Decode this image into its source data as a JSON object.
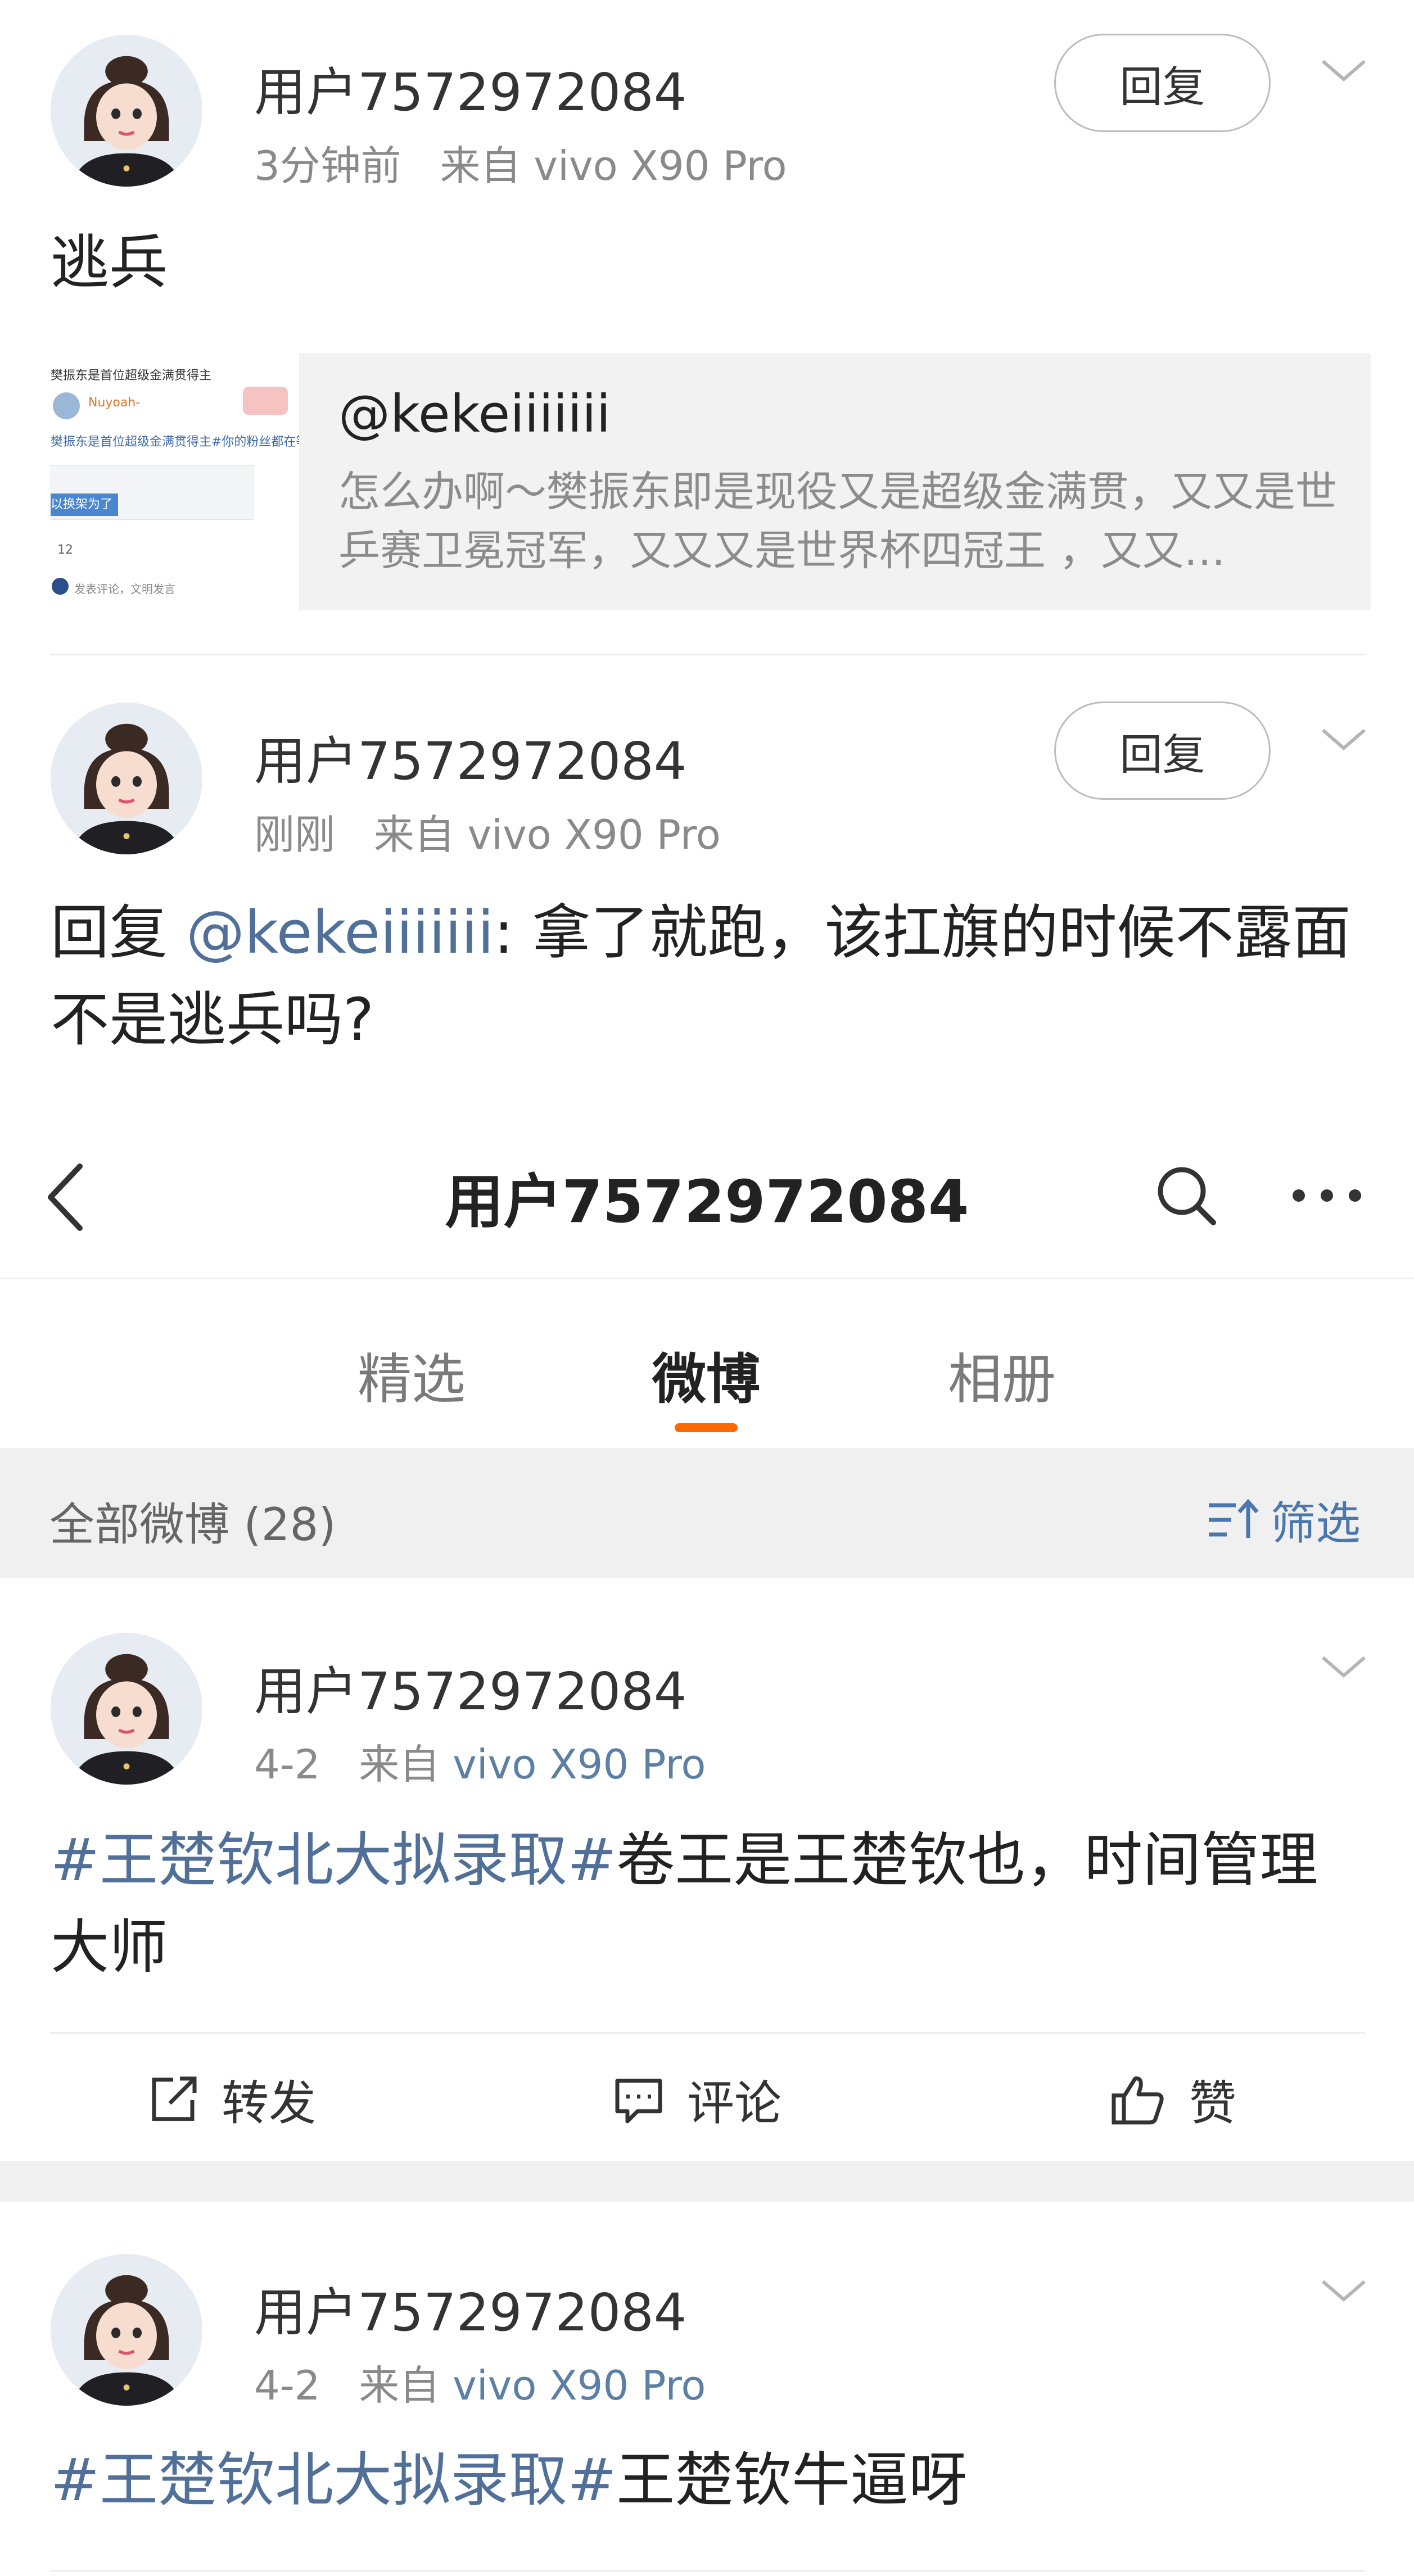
{
  "comment1": {
    "username": "用户7572972084",
    "time": "3分钟前",
    "source": "来自 vivo X90 Pro",
    "reply_label": "回复",
    "text": "逃兵",
    "quote": {
      "thumb_line1": "樊振东是首位超级金满贯得主",
      "thumb_line2": "Nuyoah-",
      "thumb_line3": "樊振东是首位超级金满贯得主#你的粉丝都在等",
      "thumb_line4": "以换架为了",
      "thumb_count": "12",
      "thumb_footer": "发表评论，文明发言",
      "title": "@kekeiiiiiii",
      "text": "怎么办啊～樊振东即是现役又是超级金满贯，又又是世乒赛卫冕冠军，又又又是世界杯四冠王 ，又又…"
    }
  },
  "comment2": {
    "username": "用户7572972084",
    "time": "刚刚",
    "source": "来自 vivo X90 Pro",
    "reply_label": "回复",
    "text_prefix": "回复 ",
    "mention": "@kekeiiiiiii",
    "text_body": ": 拿了就跑，该扛旗的时候不露面",
    "text_line2": "不是逃兵吗?"
  },
  "navbar": {
    "title": "用户7572972084"
  },
  "tabs": [
    "精选",
    "微博",
    "相册"
  ],
  "active_tab": "微博",
  "filter": {
    "count_label": "全部微博 (28)",
    "filter_label": "筛选"
  },
  "post1": {
    "username": "用户7572972084",
    "date": "4-2",
    "source_prefix": "来自",
    "source": "vivo X90 Pro",
    "hashtag": "#王楚钦北大拟录取#",
    "text_rest": "卷王是王楚钦也，时间管理",
    "text_line2": "大师",
    "actions": {
      "repost": "转发",
      "comment": "评论",
      "like": "赞"
    }
  },
  "post2": {
    "username": "用户7572972084",
    "date": "4-2",
    "source_prefix": "来自",
    "source": "vivo X90 Pro",
    "hashtag": "#王楚钦北大拟录取#",
    "text_rest": "王楚钦牛逼呀"
  },
  "colors": {
    "accent": "#ff6a00",
    "link": "#50709a",
    "filter_blue": "#4a77ad"
  }
}
